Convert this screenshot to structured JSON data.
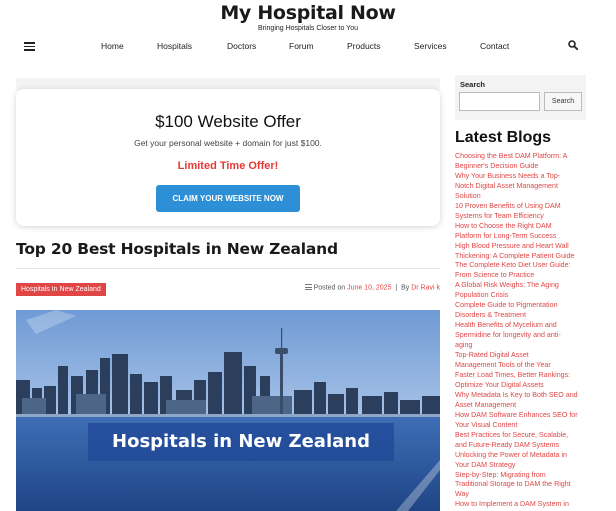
{
  "site": {
    "title": "My Hospital Now",
    "tagline": "Bringing Hospitals Closer to You"
  },
  "nav": {
    "items": [
      "Home",
      "Hospitals",
      "Doctors",
      "Forum",
      "Products",
      "Services",
      "Contact"
    ],
    "menu_icon": "hamburger-icon",
    "search_icon": "search-icon"
  },
  "offer": {
    "title": "$100 Website Offer",
    "subtitle": "Get your personal website + domain for just $100.",
    "limited": "Limited Time Offer!",
    "button": "CLAIM YOUR WEBSITE NOW"
  },
  "article": {
    "title": "Top 20 Best Hospitals in New Zealand",
    "category": "Hospitals In New Zealand",
    "posted_on_label": "Posted on",
    "date": "June 10, 2025",
    "by_label": "By",
    "author": "Dr Ravi k",
    "image_caption": "Hospitals in New Zealand"
  },
  "sidebar": {
    "search_label": "Search",
    "search_value": "",
    "search_button": "Search",
    "blogs_title": "Latest Blogs",
    "blogs": [
      "Choosing the Best DAM Platform: A",
      "Beginner's Decision Guide",
      "Why Your Business Needs a Top-",
      "Notch Digital Asset Management",
      "Solution",
      "10 Proven Benefits of Using DAM",
      "Systems for Team Efficiency",
      "How to Choose the Right DAM",
      "Platform for Long-Term Success",
      "High Blood Pressure and Heart Wall",
      "Thickening: A Complete Patient Guide",
      "The Complete Keto Diet User Guide:",
      "From Science to Practice",
      "A Global Risk Weighs: The Aging",
      "Population Crisis",
      "Complete Guide to Pigmentation",
      "Disorders & Treatment",
      "Health Benefits of Mycelium and",
      "Spermidine for longevity and anti-",
      "aging",
      "Top-Rated Digital Asset",
      "Management Tools of the Year",
      "Faster Load Times, Better Rankings:",
      "Optimize Your Digital Assets",
      "Why Metadata Is Key to Both SEO and",
      "Asset Management",
      "How DAM Software Enhances SEO for",
      "Your Visual Content",
      "Best Practices for Secure, Scalable,",
      "and Future-Ready DAM Systems",
      "Unlocking the Power of Metadata in",
      "Your DAM Strategy",
      "Step-by-Step: Migrating from",
      "Traditional Storage to DAM the Right",
      "Way",
      "How to Implement a DAM System in"
    ]
  },
  "colors": {
    "accent_red": "#e04646",
    "button_blue": "#2d8fd6",
    "limited_red": "#e53935"
  }
}
